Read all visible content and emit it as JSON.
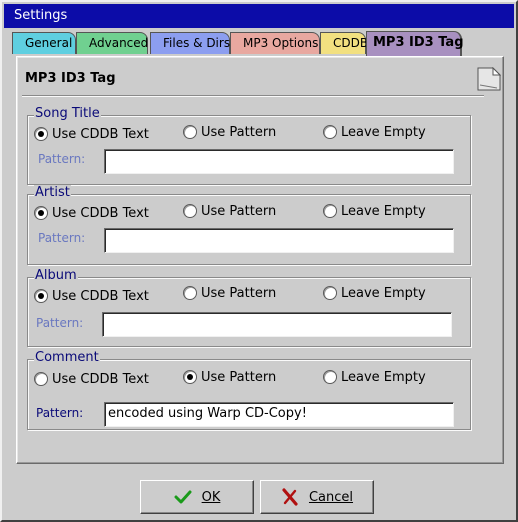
{
  "window": {
    "title": "Settings"
  },
  "tabs": [
    {
      "label": "General",
      "color": "#5fcfe0"
    },
    {
      "label": "Advanced",
      "color": "#70d090"
    },
    {
      "label": "Files & Dirs",
      "color": "#8c9ef0"
    },
    {
      "label": "MP3 Options",
      "color": "#e8a8a0"
    },
    {
      "label": "CDDB",
      "color": "#f2e080"
    },
    {
      "label": "MP3 ID3 Tag",
      "color": "#a890c0",
      "active": true
    }
  ],
  "panel": {
    "title": "MP3 ID3 Tag"
  },
  "options": {
    "use_cddb": "Use CDDB Text",
    "use_pattern": "Use Pattern",
    "leave_empty": "Leave Empty",
    "pattern_label": "Pattern:"
  },
  "groups": {
    "song_title": {
      "label": "Song Title",
      "selected": "Use CDDB Text",
      "pattern": ""
    },
    "artist": {
      "label": "Artist",
      "selected": "Use CDDB Text",
      "pattern": ""
    },
    "album": {
      "label": "Album",
      "selected": "Use CDDB Text",
      "pattern": ""
    },
    "comment": {
      "label": "Comment",
      "selected": "Use Pattern",
      "pattern": "encoded using Warp CD-Copy!"
    }
  },
  "buttons": {
    "ok": "OK",
    "cancel": "Cancel"
  },
  "icons": {
    "ok": "check-icon",
    "cancel": "x-icon",
    "page": "page-corner-icon"
  },
  "colors": {
    "title_bar": "#0c0ca8",
    "group_label": "#0a0a78",
    "ok_check": "#1a9a1a",
    "cancel_x": "#b01010"
  }
}
